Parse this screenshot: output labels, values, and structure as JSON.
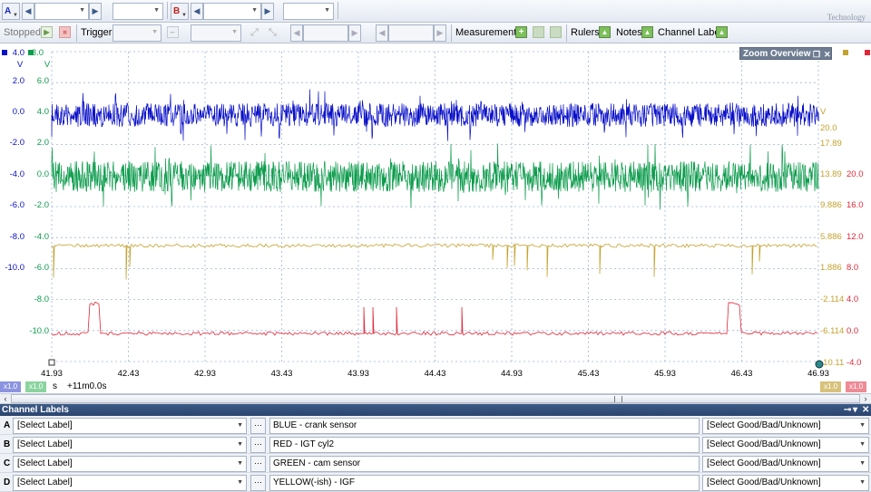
{
  "toolbar1": {
    "channel_a_letter": "A",
    "channel_b_letter": "B",
    "logo_text": "Technology"
  },
  "toolbar2": {
    "status": "Stopped",
    "trigger_label": "Trigger",
    "measurements_label": "Measurements",
    "rulers_label": "Rulers",
    "notes_label": "Notes",
    "channel_labels_label": "Channel Labels"
  },
  "scope": {
    "zoom_overview_label": "Zoom Overview",
    "colors": {
      "blue": "#0a10c8",
      "green": "#0c9c4c",
      "yellow": "#c4a22e",
      "red": "#e0283a",
      "grid": "#9fb6d6"
    },
    "left_units": [
      "V",
      "V"
    ],
    "axis_blue": [
      "4.0",
      "2.0",
      "0.0",
      "-2.0",
      "-4.0",
      "-6.0",
      "-8.0",
      "-10.0"
    ],
    "axis_green": [
      "8.0",
      "6.0",
      "4.0",
      "2.0",
      "0.0",
      "-2.0",
      "-4.0",
      "-6.0",
      "-8.0",
      "-10.0"
    ],
    "axis_yellow": [
      "V",
      "20.0",
      "17.89",
      "13.89",
      "9.886",
      "5.886",
      "1.886",
      "-2.114",
      "-6.114",
      "-10.11"
    ],
    "axis_red": [
      "20.0",
      "16.0",
      "12.0",
      "8.0",
      "4.0",
      "0.0",
      "-4.0"
    ],
    "time_ticks": [
      "41.93",
      "42.43",
      "42.93",
      "43.43",
      "43.93",
      "44.43",
      "44.93",
      "45.43",
      "45.93",
      "46.43",
      "46.93"
    ]
  },
  "timebar": {
    "badge_left_1": "x1.0",
    "badge_left_2": "x1.0",
    "unit": "s",
    "offset": "+11m0.0s",
    "badge_right_1": "x1.0",
    "badge_right_2": "x1.0"
  },
  "channel_labels": {
    "title": "Channel Labels",
    "rows": [
      {
        "letter": "A",
        "label": "[Select Label]",
        "description": "BLUE - crank sensor",
        "rating": "[Select Good/Bad/Unknown]"
      },
      {
        "letter": "B",
        "label": "[Select Label]",
        "description": "RED - IGT cyl2",
        "rating": "[Select Good/Bad/Unknown]"
      },
      {
        "letter": "C",
        "label": "[Select Label]",
        "description": "GREEN - cam sensor",
        "rating": "[Select Good/Bad/Unknown]"
      },
      {
        "letter": "D",
        "label": "[Select Label]",
        "description": "YELLOW(-ish) - IGF",
        "rating": "[Select Good/Bad/Unknown]"
      }
    ]
  }
}
